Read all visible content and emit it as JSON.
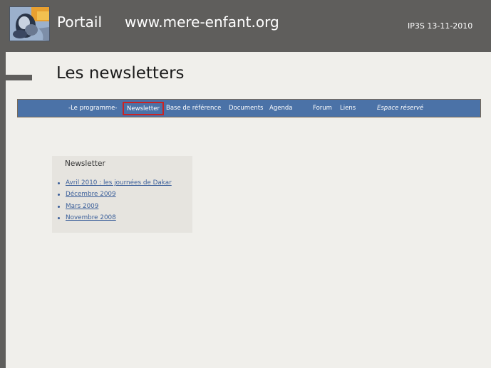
{
  "header": {
    "portal_title": "Portail",
    "site_url": "www.mere-enfant.org",
    "date_label": "IP3S 13-11-2010"
  },
  "page": {
    "heading": "Les newsletters"
  },
  "nav": {
    "items": [
      {
        "label": "-Le programme-"
      },
      {
        "label": "Newsletter"
      },
      {
        "label": "Base de référence"
      },
      {
        "label": "Documents"
      },
      {
        "label": "Agenda"
      },
      {
        "label": "Forum"
      },
      {
        "label": "Liens"
      },
      {
        "label": "Espace réservé"
      }
    ],
    "active_index": 1
  },
  "newsletter_panel": {
    "title": "Newsletter",
    "links": [
      {
        "label": "Avril 2010 : les journées de Dakar"
      },
      {
        "label": "Décembre 2009"
      },
      {
        "label": "Mars 2009"
      },
      {
        "label": "Novembre 2008"
      }
    ]
  },
  "colors": {
    "header_bg": "#5f5e5c",
    "nav_bg": "#4b72a7",
    "active_border": "#cc2222",
    "link": "#3b5f9a",
    "panel_bg": "#e6e4df",
    "page_bg": "#f0efeb"
  },
  "icons": {
    "logo": "mother-child-logo-icon",
    "bullet": "bullet-icon"
  }
}
